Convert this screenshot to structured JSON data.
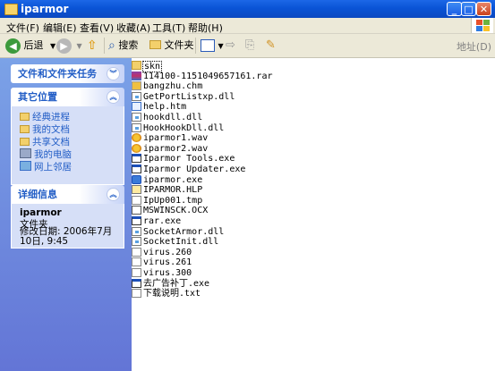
{
  "window": {
    "title": "iparmor"
  },
  "menu": [
    "文件(F)",
    "编辑(E)",
    "查看(V)",
    "收藏(A)",
    "工具(T)",
    "帮助(H)"
  ],
  "toolbar": {
    "back": "后退",
    "search": "搜索",
    "folders": "文件夹",
    "address": "地址(D)"
  },
  "left": {
    "tasks_title": "文件和文件夹任务",
    "other_title": "其它位置",
    "other_links": [
      "经典进程",
      "我的文档",
      "共享文档",
      "我的电脑",
      "网上邻居"
    ],
    "details_title": "详细信息",
    "details": {
      "name": "iparmor",
      "type": "文件夹",
      "modified": "修改日期: 2006年7月10日, 9:45"
    }
  },
  "files": [
    {
      "name": "skn",
      "type": "folder"
    },
    {
      "name": "114100-1151049657161.rar",
      "type": "rar"
    },
    {
      "name": "bangzhu.chm",
      "type": "chm"
    },
    {
      "name": "GetPortListxp.dll",
      "type": "dll"
    },
    {
      "name": "help.htm",
      "type": "htm"
    },
    {
      "name": "hookdll.dll",
      "type": "dll"
    },
    {
      "name": "HookHookDll.dll",
      "type": "dll"
    },
    {
      "name": "iparmor1.wav",
      "type": "wav"
    },
    {
      "name": "iparmor2.wav",
      "type": "wav"
    },
    {
      "name": "Iparmor Tools.exe",
      "type": "exe"
    },
    {
      "name": "Iparmor Updater.exe",
      "type": "exe"
    },
    {
      "name": "iparmor.exe",
      "type": "exe2"
    },
    {
      "name": "IPARMOR.HLP",
      "type": "hlp"
    },
    {
      "name": "IpUp001.tmp",
      "type": "gen"
    },
    {
      "name": "MSWINSCK.OCX",
      "type": "ocx"
    },
    {
      "name": "rar.exe",
      "type": "exe"
    },
    {
      "name": "SocketArmor.dll",
      "type": "dll"
    },
    {
      "name": "SocketInit.dll",
      "type": "dll"
    },
    {
      "name": "virus.260",
      "type": "gen"
    },
    {
      "name": "virus.261",
      "type": "gen"
    },
    {
      "name": "virus.300",
      "type": "gen"
    },
    {
      "name": "去广告补丁.exe",
      "type": "exe"
    },
    {
      "name": "下载说明.txt",
      "type": "txt"
    }
  ]
}
